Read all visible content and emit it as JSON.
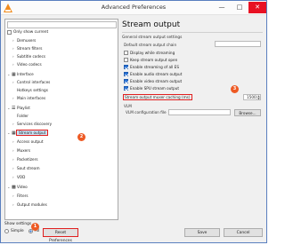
{
  "window": {
    "title": "Advanced Preferences",
    "controls": {
      "minimize": "—",
      "maximize": "□",
      "close": "✕"
    }
  },
  "left": {
    "search_placeholder": "",
    "show_only_current": "Only show current",
    "tree": [
      {
        "label": "Demuxers",
        "caret": "›"
      },
      {
        "label": "Stream filters",
        "caret": "›"
      },
      {
        "label": "Subtitle codecs",
        "caret": "›"
      },
      {
        "label": "Video codecs",
        "caret": "›"
      },
      {
        "label": "Interface",
        "caret": "⌄",
        "icon": "interface-icon"
      },
      {
        "label": "Control interfaces",
        "caret": "›"
      },
      {
        "label": "Hotkeys settings",
        "caret": ""
      },
      {
        "label": "Main interfaces",
        "caret": "›"
      },
      {
        "label": "Playlist",
        "caret": "⌄",
        "icon": "playlist-icon"
      },
      {
        "label": "Folder",
        "caret": ""
      },
      {
        "label": "Services discovery",
        "caret": "›"
      },
      {
        "label": "Stream output",
        "caret": "⌄",
        "icon": "stream-output-icon"
      },
      {
        "label": "Access output",
        "caret": "›"
      },
      {
        "label": "Muxers",
        "caret": "›"
      },
      {
        "label": "Packetizers",
        "caret": "›"
      },
      {
        "label": "Sout stream",
        "caret": "›"
      },
      {
        "label": "VOD",
        "caret": "›"
      },
      {
        "label": "Video",
        "caret": "⌄",
        "icon": "video-icon"
      },
      {
        "label": "Filters",
        "caret": "›"
      },
      {
        "label": "Output modules",
        "caret": "›"
      }
    ]
  },
  "bottom": {
    "show_settings": "Show settings",
    "simple": "Simple",
    "all": "All",
    "reset": "Reset Preferences",
    "save": "Save",
    "cancel": "Cancel"
  },
  "markers": {
    "m1": "1",
    "m2": "2",
    "m3": "3"
  },
  "right": {
    "title": "Stream output",
    "group": "General stream output settings",
    "default_chain_label": "Default stream output chain",
    "default_chain_value": "",
    "options": [
      {
        "label": "Display while streaming",
        "checked": false
      },
      {
        "label": "Keep stream output open",
        "checked": false
      },
      {
        "label": "Enable streaming of all ES",
        "checked": true
      },
      {
        "label": "Enable audio stream output",
        "checked": true
      },
      {
        "label": "Enable video stream output",
        "checked": true
      },
      {
        "label": "Enable SPU stream output",
        "checked": true
      }
    ],
    "caching_label": "Stream output muxer caching (ms)",
    "caching_value": "1500",
    "vlm_group": "VLM",
    "vlm_label": "VLM configuration file",
    "vlm_value": "",
    "browse": "Browse..."
  },
  "colors": {
    "highlight": "#e01f1f",
    "marker": "#ee5a24",
    "accent": "#2b74d6"
  }
}
